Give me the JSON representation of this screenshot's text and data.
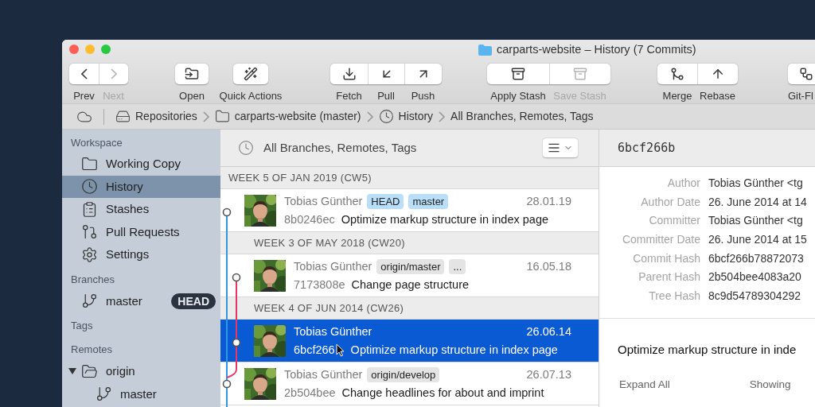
{
  "window": {
    "title": "carparts-website – History (7 Commits)"
  },
  "toolbar": [
    {
      "buttons": [
        {
          "label": "Prev",
          "disabled": false
        },
        {
          "label": "Next",
          "disabled": true
        }
      ]
    },
    {
      "buttons": [
        {
          "label": "Open",
          "disabled": false
        }
      ]
    },
    {
      "buttons": [
        {
          "label": "Quick Actions",
          "disabled": false
        }
      ]
    },
    {
      "buttons": [
        {
          "label": "Fetch",
          "disabled": false
        },
        {
          "label": "Pull",
          "disabled": false
        },
        {
          "label": "Push",
          "disabled": false
        }
      ]
    },
    {
      "buttons": [
        {
          "label": "Apply Stash",
          "disabled": false
        },
        {
          "label": "Save Stash",
          "disabled": true
        }
      ]
    },
    {
      "buttons": [
        {
          "label": "Merge",
          "disabled": false
        },
        {
          "label": "Rebase",
          "disabled": false
        }
      ]
    },
    {
      "buttons": [
        {
          "label": "Git-Fl",
          "disabled": false
        }
      ]
    }
  ],
  "breadcrumb": [
    "Repositories",
    "carparts-website (master)",
    "History",
    "All Branches, Remotes, Tags"
  ],
  "sidebar": [
    {
      "title": "Workspace",
      "items": [
        {
          "kind": "folder",
          "label": "Working Copy",
          "selected": false
        },
        {
          "kind": "clock",
          "label": "History",
          "selected": true
        },
        {
          "kind": "stash",
          "label": "Stashes",
          "selected": false
        },
        {
          "kind": "pull-request",
          "label": "Pull Requests",
          "selected": false
        },
        {
          "kind": "gear",
          "label": "Settings",
          "selected": false
        }
      ]
    },
    {
      "title": "Branches",
      "items": [
        {
          "kind": "branch",
          "label": "master",
          "selected": false,
          "badge": "HEAD"
        }
      ]
    },
    {
      "title": "Tags"
    },
    {
      "title": "Remotes",
      "items": [
        {
          "kind": "remote",
          "label": "origin",
          "selected": false,
          "expanded": true,
          "children": [
            {
              "kind": "branch",
              "label": "master",
              "selected": false
            }
          ]
        }
      ]
    }
  ],
  "history": {
    "filter": "All Branches, Remotes, Tags",
    "weeks": [
      {
        "title": "WEEK 5 OF JAN 2019 (CW5)",
        "commits": [
          {
            "kind": "main",
            "author": "Tobias Günther",
            "refs": [
              {
                "kind": "local",
                "label": "HEAD"
              },
              {
                "kind": "local",
                "label": "master"
              }
            ],
            "date": "28.01.19",
            "hash": "8b0246ec",
            "message": "Optimize markup structure in index page",
            "selected": false
          }
        ]
      },
      {
        "title": "WEEK 3 OF MAY 2018 (CW20)",
        "commits": [
          {
            "kind": "side",
            "author": "Tobias Günther",
            "refs": [
              {
                "kind": "remote",
                "label": "origin/master"
              },
              {
                "kind": "remote",
                "label": "..."
              }
            ],
            "date": "16.05.18",
            "hash": "7173808e",
            "message": "Change page structure",
            "selected": false
          }
        ]
      },
      {
        "title": "WEEK 4 OF JUN 2014 (CW26)",
        "commits": [
          {
            "kind": "side",
            "author": "Tobias Günther",
            "date": "26.06.14",
            "hash": "6bcf266",
            "message": "Optimize markup structure in index page",
            "selected": true
          },
          {
            "kind": "main",
            "author": "Tobias Günther",
            "refs": [
              {
                "kind": "remote",
                "label": "origin/develop"
              }
            ],
            "date": "26.07.13",
            "hash": "2b504bee",
            "message": "Change headlines for about and imprint",
            "selected": false
          }
        ]
      }
    ]
  },
  "details": {
    "hash": "6bcf266b",
    "fields": [
      {
        "label": "Author",
        "value": "Tobias Günther <tg"
      },
      {
        "label": "Author Date",
        "value": "26. June 2014 at 14"
      },
      {
        "label": "Committer",
        "value": "Tobias Günther <tg"
      },
      {
        "label": "Committer Date",
        "value": "26. June 2014 at 15"
      },
      {
        "label": "Commit Hash",
        "value": "6bcf266b78872073"
      },
      {
        "label": "Parent Hash",
        "value": "2b504bee4083a20"
      },
      {
        "label": "Tree Hash",
        "value": "8c9d54789304292"
      }
    ],
    "message": "Optimize markup structure in inde",
    "expand_all": "Expand All",
    "showing": "Showing"
  }
}
